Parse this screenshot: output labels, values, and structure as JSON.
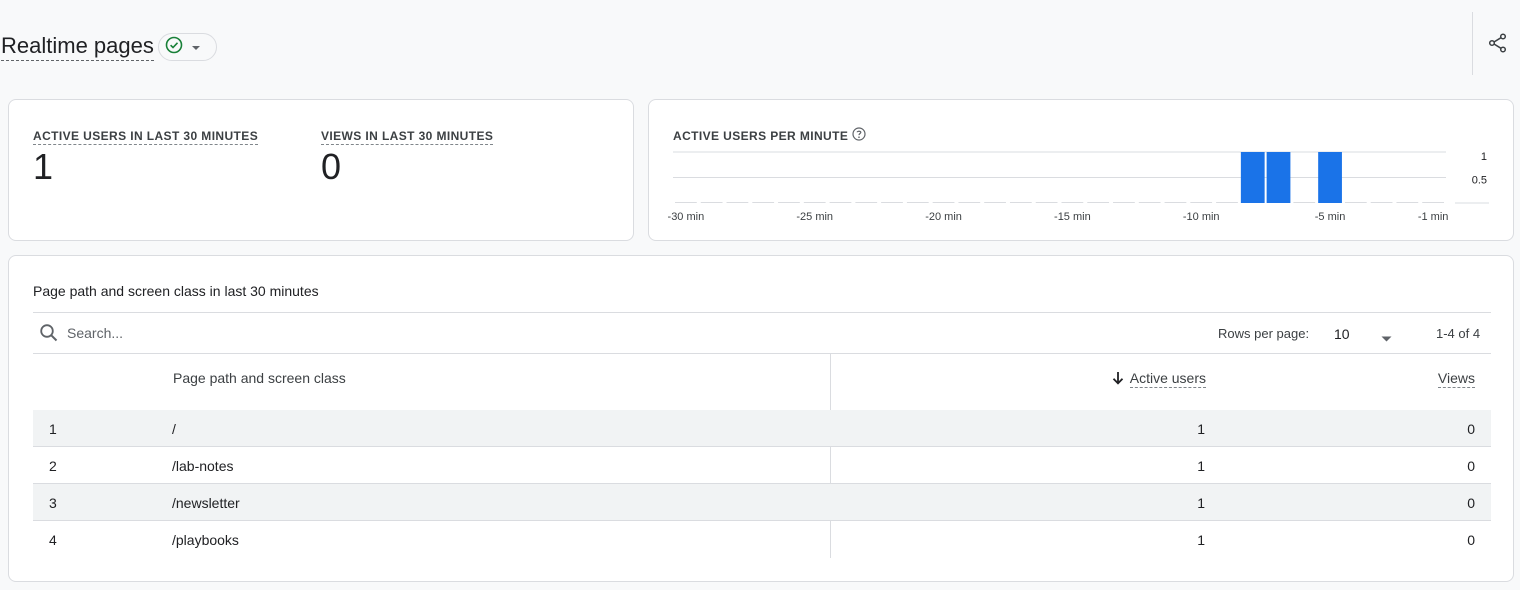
{
  "header": {
    "title": "Realtime pages"
  },
  "colors": {
    "accent": "#1a73e8",
    "status_ok": "#188038",
    "bar": "#1a73e8"
  },
  "summary": {
    "active_users_label": "ACTIVE USERS IN LAST 30 MINUTES",
    "active_users_value": "1",
    "views_label": "VIEWS IN LAST 30 MINUTES",
    "views_value": "0"
  },
  "chart_card": {
    "title": "ACTIVE USERS PER MINUTE"
  },
  "chart_data": {
    "type": "bar",
    "title": "ACTIVE USERS PER MINUTE",
    "xlabel": "",
    "ylabel": "",
    "categories": [
      "-30 min",
      "-29 min",
      "-28 min",
      "-27 min",
      "-26 min",
      "-25 min",
      "-24 min",
      "-23 min",
      "-22 min",
      "-21 min",
      "-20 min",
      "-19 min",
      "-18 min",
      "-17 min",
      "-16 min",
      "-15 min",
      "-14 min",
      "-13 min",
      "-12 min",
      "-11 min",
      "-10 min",
      "-9 min",
      "-8 min",
      "-7 min",
      "-6 min",
      "-5 min",
      "-4 min",
      "-3 min",
      "-2 min",
      "-1 min"
    ],
    "values": [
      0,
      0,
      0,
      0,
      0,
      0,
      0,
      0,
      0,
      0,
      0,
      0,
      0,
      0,
      0,
      0,
      0,
      0,
      0,
      0,
      0,
      0,
      1,
      1,
      0,
      1,
      0,
      0,
      0,
      0
    ],
    "x_tick_labels": [
      "-30 min",
      "-25 min",
      "-20 min",
      "-15 min",
      "-10 min",
      "-5 min",
      "-1 min"
    ],
    "y_tick_labels": [
      "1",
      "0.5"
    ],
    "ylim": [
      0,
      1
    ],
    "grid": true,
    "y_axis_side": "right"
  },
  "table": {
    "title": "Page path and screen class in last 30 minutes",
    "search_placeholder": "Search...",
    "rows_per_page_label": "Rows per page:",
    "rows_per_page_value": "10",
    "pagination": "1-4 of 4",
    "columns": {
      "page": "Page path and screen class",
      "active_users": "Active users",
      "views": "Views"
    },
    "rows": [
      {
        "index": "1",
        "path": "/",
        "active_users": "1",
        "views": "0"
      },
      {
        "index": "2",
        "path": "/lab-notes",
        "active_users": "1",
        "views": "0"
      },
      {
        "index": "3",
        "path": "/newsletter",
        "active_users": "1",
        "views": "0"
      },
      {
        "index": "4",
        "path": "/playbooks",
        "active_users": "1",
        "views": "0"
      }
    ]
  }
}
